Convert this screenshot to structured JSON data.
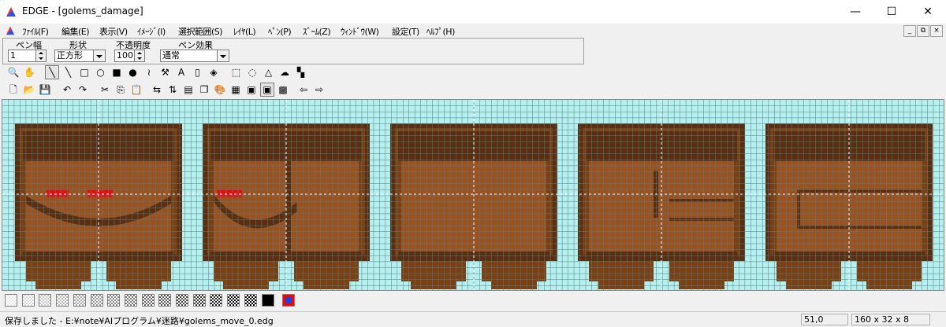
{
  "window": {
    "title": "EDGE - [golems_damage]",
    "controls": {
      "minimize": "—",
      "maximize": "☐",
      "close": "✕"
    }
  },
  "menu": {
    "items": [
      "ﾌｧｲﾙ(F)",
      "編集(E)",
      "表示(V)",
      "ｲﾒｰｼﾞ(I)",
      "選択範囲(S)",
      "ﾚｲﾔ(L)",
      "ﾍﾟﾝ(P)",
      "ｽﾞｰﾑ(Z)",
      "ｳｨﾝﾄﾞｳ(W)",
      "設定(T)",
      "ﾍﾙﾌﾟ(H)"
    ],
    "mdi_controls": [
      "_",
      "⧉",
      "×"
    ]
  },
  "pen_props": {
    "width_label": "ペン幅",
    "width_value": "1",
    "shape_label": "形状",
    "shape_value": "正方形",
    "opacity_label": "不透明度",
    "opacity_value": "100",
    "effect_label": "ペン効果",
    "effect_value": "通常"
  },
  "toolbar_draw": {
    "icons": [
      "zoom-icon",
      "hand-icon",
      "pen-icon",
      "line-icon",
      "rect-outline-icon",
      "ellipse-outline-icon",
      "rect-fill-icon",
      "ellipse-fill-icon",
      "curve-icon",
      "spuit-icon",
      "text-icon",
      "bucket-icon",
      "fill-icon",
      "rect-select-icon",
      "ellipse-select-icon",
      "lasso-select-icon",
      "magic-select-icon",
      "tile-select-icon"
    ],
    "glyphs": [
      "🔍",
      "✋",
      "╲",
      "╲",
      "□",
      "○",
      "■",
      "●",
      "≀",
      "⚒",
      "A",
      "▯",
      "◈",
      "⬚",
      "◌",
      "△",
      "☁",
      "▚"
    ],
    "pressed_index": 2
  },
  "toolbar_file": {
    "icons": [
      "new-file-icon",
      "open-folder-icon",
      "save-icon",
      "undo-icon",
      "redo-icon",
      "cut-icon",
      "copy-icon",
      "paste-icon",
      "flip-h-icon",
      "flip-v-icon",
      "grid-icon",
      "layer-icon",
      "palette-icon",
      "frame-icon",
      "frame-view-icon",
      "frame-view2-icon",
      "anim-grid-icon",
      "prev-frame-icon",
      "next-frame-icon"
    ],
    "glyphs": [
      "🗋",
      "📂",
      "💾",
      "↶",
      "↷",
      "✂",
      "⎘",
      "📋",
      "⇆",
      "⇅",
      "▤",
      "❐",
      "🎨",
      "▦",
      "▣",
      "▣",
      "▩",
      "⇦",
      "⇨"
    ],
    "pressed_index": 15
  },
  "colors": {
    "background": "#b4f0f0",
    "grid_line": "#5c7c7c",
    "dark_brown": "#5a2e10",
    "brown": "#7a3f12",
    "light_brown": "#9a5220",
    "eye_red": "#e01010",
    "fg_color": "#000000",
    "bg_color": "#ff0000"
  },
  "status": {
    "message": "保存しました - E:¥note¥AIプログラム¥迷路¥golems_move_0.edg",
    "coords": "51,0",
    "size": "160 x 32 x 8"
  }
}
